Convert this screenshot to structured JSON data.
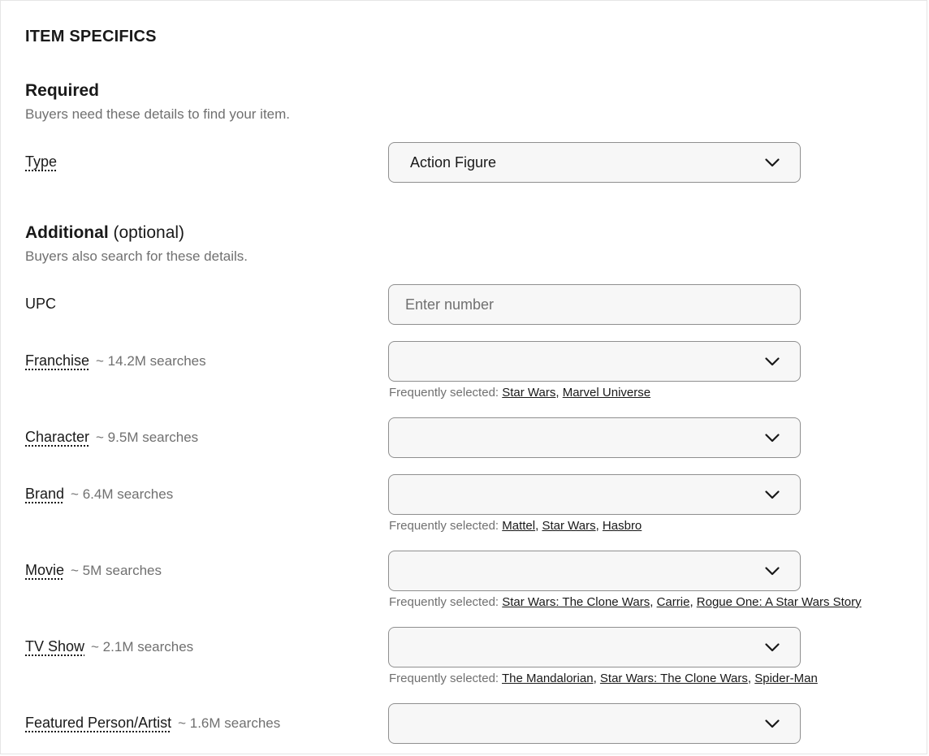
{
  "section": {
    "title": "ITEM SPECIFICS"
  },
  "required": {
    "heading": "Required",
    "subtitle": "Buyers need these details to find your item.",
    "type_label": "Type",
    "type_value": "Action Figure"
  },
  "additional": {
    "heading_strong": "Additional",
    "heading_light": "(optional)",
    "subtitle": "Buyers also search for these details.",
    "upc_label": "UPC",
    "upc_placeholder": "Enter number",
    "freq_prefix": "Frequently selected:",
    "rows": [
      {
        "label": "Franchise",
        "count": "~ 14.2M searches",
        "value": "",
        "frequent": [
          "Star Wars",
          "Marvel Universe"
        ]
      },
      {
        "label": "Character",
        "count": "~ 9.5M searches",
        "value": "",
        "frequent": []
      },
      {
        "label": "Brand",
        "count": "~ 6.4M searches",
        "value": "",
        "frequent": [
          "Mattel",
          "Star Wars",
          "Hasbro"
        ]
      },
      {
        "label": "Movie",
        "count": "~ 5M searches",
        "value": "",
        "frequent": [
          "Star Wars: The Clone Wars",
          "Carrie",
          "Rogue One: A Star Wars Story"
        ]
      },
      {
        "label": "TV Show",
        "count": "~ 2.1M searches",
        "value": "",
        "frequent": [
          "The Mandalorian",
          "Star Wars: The Clone Wars",
          "Spider-Man"
        ]
      },
      {
        "label": "Featured Person/Artist",
        "count": "~ 1.6M searches",
        "value": "",
        "frequent": []
      }
    ]
  },
  "icons": {
    "dropdown": "chevron-down-icon"
  }
}
